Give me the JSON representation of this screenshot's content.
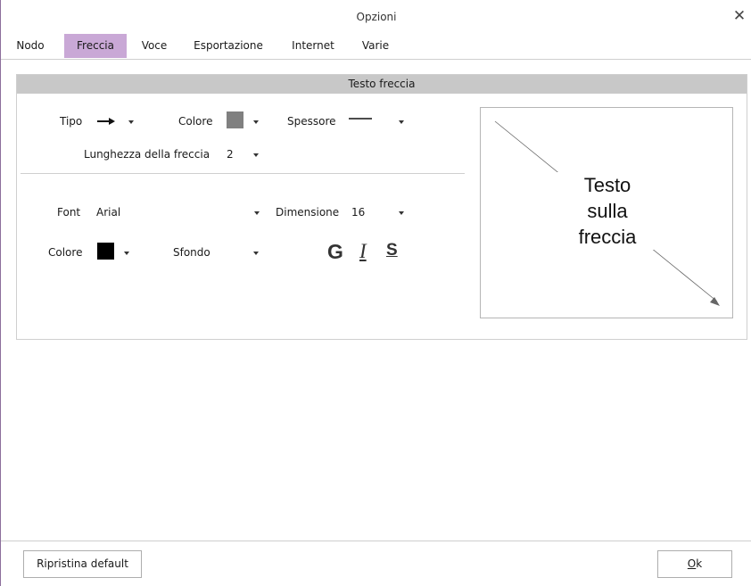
{
  "window": {
    "title": "Opzioni",
    "close_symbol": "✕"
  },
  "tabs": [
    {
      "label": "Nodo",
      "active": false
    },
    {
      "label": "Freccia",
      "active": true
    },
    {
      "label": "Voce",
      "active": false
    },
    {
      "label": "Esportazione",
      "active": false
    },
    {
      "label": "Internet",
      "active": false
    },
    {
      "label": "Varie",
      "active": false
    }
  ],
  "section": {
    "header": "Testo freccia",
    "arrow": {
      "tipo_label": "Tipo",
      "tipo_icon": "right-arrow-icon",
      "colore_label": "Colore",
      "colore_value": "#808080",
      "spessore_label": "Spessore",
      "spessore_icon": "thin-line-icon",
      "lunghezza_label": "Lunghezza della freccia",
      "lunghezza_value": "2"
    },
    "font": {
      "font_label": "Font",
      "font_value": "Arial",
      "dimensione_label": "Dimensione",
      "dimensione_value": "16",
      "colore_label": "Colore",
      "colore_value": "#000000",
      "sfondo_label": "Sfondo",
      "bold_label": "G",
      "italic_label": "I",
      "underline_label": "S"
    },
    "preview": {
      "line1": "Testo",
      "line2": "sulla",
      "line3": "freccia"
    }
  },
  "footer": {
    "reset_label": "Ripristina default",
    "ok_accel": "O",
    "ok_rest": "k"
  },
  "colors": {
    "accent": "#c9a8d6",
    "header_bg": "#c8c8c8",
    "border": "#cfcfcf"
  }
}
